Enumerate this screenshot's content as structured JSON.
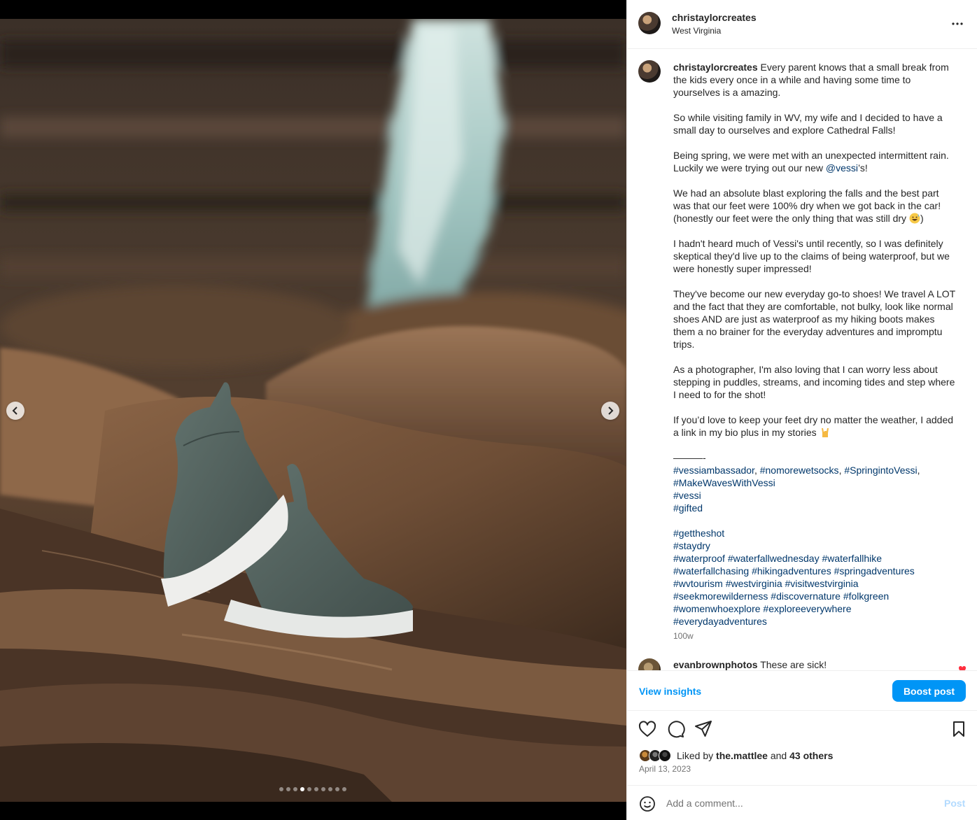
{
  "post": {
    "username": "christaylorcreates",
    "location": "West Virginia",
    "caption_parts": [
      [
        "Every parent knows that a small break from the kids every once in a while and having some time to yourselves is a amazing.\n\nSo while visiting family in WV, my wife and I decided to have a small day to ourselves and explore Cathedral Falls!\n\nBeing spring, we were met with an unexpected intermittent rain. Luckily we were trying out our new ",
        "text"
      ],
      [
        "@vessi",
        "mention"
      ],
      [
        "’s!\n\nWe had an absolute blast exploring the falls and the best part was that our feet were 100% dry when we got back in the car! (honestly our feet were the only thing that was still dry ",
        "text"
      ],
      [
        "grinning-sweat-emoji",
        "emoji"
      ],
      [
        ")\n\nI hadn't heard much of Vessi's until recently, so I was definitely skeptical they'd live up to the claims of being waterproof, but we were honestly super impressed!\n\nThey've become our new everyday go-to shoes! We travel A LOT and the fact that they are comfortable, not bulky, look like normal shoes AND are just as waterproof as my hiking boots makes them a no brainer for the everyday adventures and impromptu trips.\n\nAs a photographer, I'm also loving that I can worry less about stepping in puddles, streams, and incoming tides and step where I need to for the shot!\n\nIf you’d love to keep your feet dry no matter the weather, I added a link in my bio plus in my stories ",
        "text"
      ],
      [
        "rock-on-emoji",
        "emoji"
      ],
      [
        "\n\n———-\n",
        "text"
      ],
      [
        "#vessiambassador",
        "tag"
      ],
      [
        ", ",
        "text"
      ],
      [
        "#nomorewetsocks",
        "tag"
      ],
      [
        ", ",
        "text"
      ],
      [
        "#SpringintoVessi",
        "tag"
      ],
      [
        ",\n",
        "text"
      ],
      [
        "#MakeWavesWithVessi",
        "tag"
      ],
      [
        "\n",
        "text"
      ],
      [
        "#vessi",
        "tag"
      ],
      [
        "\n",
        "text"
      ],
      [
        "#gifted",
        "tag"
      ],
      [
        "\n\n",
        "text"
      ],
      [
        "#gettheshot",
        "tag"
      ],
      [
        "\n",
        "text"
      ],
      [
        "#staydry",
        "tag"
      ],
      [
        "\n",
        "text"
      ],
      [
        "#waterproof",
        "tag"
      ],
      [
        " ",
        "text"
      ],
      [
        "#waterfallwednesday",
        "tag"
      ],
      [
        " ",
        "text"
      ],
      [
        "#waterfallhike",
        "tag"
      ],
      [
        "\n",
        "text"
      ],
      [
        "#waterfallchasing",
        "tag"
      ],
      [
        " ",
        "text"
      ],
      [
        "#hikingadventures",
        "tag"
      ],
      [
        " ",
        "text"
      ],
      [
        "#springadventures",
        "tag"
      ],
      [
        "\n",
        "text"
      ],
      [
        "#wvtourism",
        "tag"
      ],
      [
        " ",
        "text"
      ],
      [
        "#westvirginia",
        "tag"
      ],
      [
        " ",
        "text"
      ],
      [
        "#visitwestvirginia",
        "tag"
      ],
      [
        "\n",
        "text"
      ],
      [
        "#seekmorewilderness",
        "tag"
      ],
      [
        " ",
        "text"
      ],
      [
        "#discovernature",
        "tag"
      ],
      [
        " ",
        "text"
      ],
      [
        "#folkgreen",
        "tag"
      ],
      [
        "\n",
        "text"
      ],
      [
        "#womenwhoexplore",
        "tag"
      ],
      [
        " ",
        "text"
      ],
      [
        "#exploreeverywhere",
        "tag"
      ],
      [
        "\n",
        "text"
      ],
      [
        "#everydayadventures",
        "tag"
      ]
    ],
    "caption_age": "100w",
    "date": "April 13, 2023"
  },
  "comment": {
    "username": "evanbrownphotos",
    "text": "These are sick!"
  },
  "insights": {
    "view_label": "View insights",
    "boost_label": "Boost post"
  },
  "likes": {
    "prefix": "Liked by ",
    "user": "the.mattlee",
    "middle": " and ",
    "others": "43 others"
  },
  "add_comment": {
    "placeholder": "Add a comment...",
    "post_label": "Post"
  },
  "carousel": {
    "total": 10,
    "active_index": 3
  },
  "colors": {
    "accent": "#0095f6",
    "link": "#00376b",
    "heart": "#ff3040"
  },
  "icons": [
    "more-options-icon",
    "chevron-left-icon",
    "chevron-right-icon",
    "heart-icon",
    "comment-bubble-icon",
    "share-plane-icon",
    "bookmark-icon",
    "emoji-face-icon"
  ]
}
